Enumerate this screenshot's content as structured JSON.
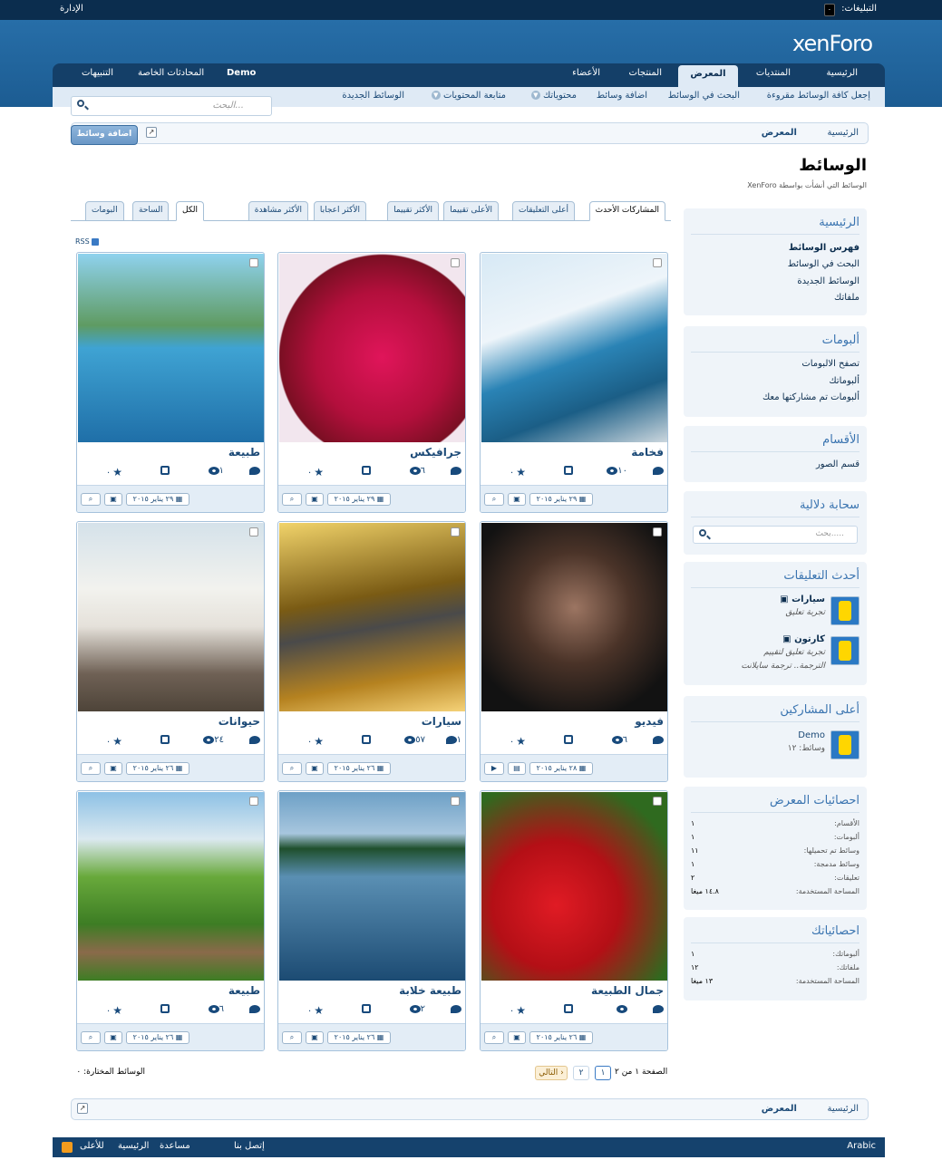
{
  "topbar": {
    "notices_label": "التبليغات:",
    "notices_count": "٠",
    "admin": "الإدارة"
  },
  "logo": {
    "main": "xenForo"
  },
  "nav": {
    "tabs": [
      "الرئيسية",
      "المنتديات",
      "المعرض",
      "المنتجات",
      "الأعضاء"
    ],
    "user": "Demo",
    "inbox": "المحادثات الخاصة",
    "alerts": "التنبيهات"
  },
  "subnav": {
    "items": [
      "إجعل كافة الوسائط مقروءة",
      "البحث في الوسائط",
      "اضافة وسائط",
      "محتوياتك",
      "متابعة المحتويات",
      "الوسائط الجديدة"
    ]
  },
  "search": {
    "placeholder": "البحث..."
  },
  "breadcrumb": [
    "الرئيسية",
    "المعرض"
  ],
  "add_media": "اضافة وسائط",
  "page": {
    "title": "الوسائط",
    "description": "الوسائط التي أنشأت بواسطة XenForo"
  },
  "sort_tabs": [
    "المشاركات الأحدث",
    "أعلى التعليقات",
    "الأعلى تقييما",
    "الأكثر تقييما",
    "الأكثر اعجابا",
    "الأكثر مشاهدة"
  ],
  "filter_tabs": [
    "الكل",
    "الساحة",
    "البومات"
  ],
  "rss": "RSS",
  "cards": [
    {
      "title": "فخامة",
      "comments": "",
      "views": "١٠",
      "likes": "",
      "rating": "٠",
      "date": "٢٩ يناير ٢٠١٥"
    },
    {
      "title": "جرافيكس",
      "comments": "",
      "views": "٦",
      "likes": "",
      "rating": "٠",
      "date": "٢٩ يناير ٢٠١٥"
    },
    {
      "title": "طبيعة",
      "comments": "",
      "views": "١",
      "likes": "",
      "rating": "٠",
      "date": "٢٩ يناير ٢٠١٥"
    },
    {
      "title": "فيديو",
      "comments": "",
      "views": "٦",
      "likes": "",
      "rating": "٠",
      "date": "٢٨ يناير ٢٠١٥"
    },
    {
      "title": "سيارات",
      "comments": "١",
      "views": "٥٧",
      "likes": "",
      "rating": "٠",
      "date": "٢٦ يناير ٢٠١٥"
    },
    {
      "title": "حيوانات",
      "comments": "",
      "views": "٢٤",
      "likes": "",
      "rating": "٠",
      "date": "٢٦ يناير ٢٠١٥"
    },
    {
      "title": "جمال الطبيعة",
      "comments": "",
      "views": "",
      "likes": "",
      "rating": "٠",
      "date": "٢٦ يناير ٢٠١٥"
    },
    {
      "title": "طبيعة خلابة",
      "comments": "",
      "views": "٢",
      "likes": "",
      "rating": "٠",
      "date": "٢٦ يناير ٢٠١٥"
    },
    {
      "title": "طبيعة",
      "comments": "",
      "views": "٦",
      "likes": "",
      "rating": "٠",
      "date": "٢٦ يناير ٢٠١٥"
    }
  ],
  "pagination": {
    "label": "الصفحة ١ من ٢",
    "pages": [
      "١",
      "٢"
    ],
    "next": "التالي ›",
    "selected": "الوسائط المختارة: ٠"
  },
  "sidebar": {
    "home": {
      "title": "الرئيسية",
      "links": [
        "فهرس الوسائط",
        "البحث في الوسائط",
        "الوسائط الجديدة",
        "ملفاتك"
      ]
    },
    "albums": {
      "title": "ألبومات",
      "links": [
        "تصفح الالبومات",
        "ألبوماتك",
        "ألبومات تم مشاركتها معك"
      ]
    },
    "categories": {
      "title": "الأقسام",
      "links": [
        "قسم الصور"
      ]
    },
    "tags": {
      "title": "سحابة دلالية",
      "placeholder": "بحث....."
    },
    "comments": {
      "title": "أحدث التعليقات",
      "items": [
        {
          "media": "سيارات",
          "text": "تجربة تعليق",
          "text2": ""
        },
        {
          "media": "كارتون",
          "text": "تجربة تعليق لتقييم",
          "text2": "الترجمة.. ترجمة سايلانت"
        }
      ]
    },
    "posters": {
      "title": "أعلى المشاركين",
      "name": "Demo",
      "media": "وسائط: ١٢"
    },
    "stats": {
      "title": "احصائيات المعرض",
      "rows": [
        [
          "الأقسام:",
          "١"
        ],
        [
          "ألبومات:",
          "١"
        ],
        [
          "وسائط تم تحميلها:",
          "١١"
        ],
        [
          "وسائط مدمجة:",
          "١"
        ],
        [
          "تعليقات:",
          "٢"
        ],
        [
          "المساحة المستخدمة:",
          "١٤.٨ ميغا"
        ]
      ]
    },
    "mystats": {
      "title": "احصائياتك",
      "rows": [
        [
          "ألبوماتك:",
          "١"
        ],
        [
          "ملفاتك:",
          "١٢"
        ],
        [
          "المساحة المستخدمة:",
          "١٣ ميغا"
        ]
      ]
    }
  },
  "footer": {
    "links": [
      "إتصل بنا",
      "مساعدة",
      "الرئيسية",
      "للأعلى"
    ],
    "language": "Arabic"
  }
}
